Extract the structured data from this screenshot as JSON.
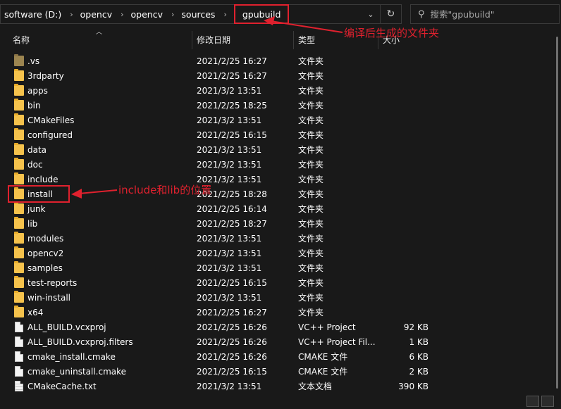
{
  "address_bar": {
    "breadcrumbs": [
      "software (D:)",
      "opencv",
      "opencv",
      "sources",
      "gpubuild"
    ],
    "dropdown_icon": "chevron-down-icon",
    "refresh_icon": "refresh-icon"
  },
  "search": {
    "placeholder": "搜索\"gpubuild\"",
    "icon": "search-icon"
  },
  "columns": {
    "name": "名称",
    "date": "修改日期",
    "type": "类型",
    "size": "大小"
  },
  "files": [
    {
      "name": ".vs",
      "date": "2021/2/25 16:27",
      "type": "文件夹",
      "size": "",
      "icon": "folder-dark-icon"
    },
    {
      "name": "3rdparty",
      "date": "2021/2/25 16:27",
      "type": "文件夹",
      "size": "",
      "icon": "folder-icon"
    },
    {
      "name": "apps",
      "date": "2021/3/2 13:51",
      "type": "文件夹",
      "size": "",
      "icon": "folder-icon"
    },
    {
      "name": "bin",
      "date": "2021/2/25 18:25",
      "type": "文件夹",
      "size": "",
      "icon": "folder-icon"
    },
    {
      "name": "CMakeFiles",
      "date": "2021/3/2 13:51",
      "type": "文件夹",
      "size": "",
      "icon": "folder-icon"
    },
    {
      "name": "configured",
      "date": "2021/2/25 16:15",
      "type": "文件夹",
      "size": "",
      "icon": "folder-icon"
    },
    {
      "name": "data",
      "date": "2021/3/2 13:51",
      "type": "文件夹",
      "size": "",
      "icon": "folder-icon"
    },
    {
      "name": "doc",
      "date": "2021/3/2 13:51",
      "type": "文件夹",
      "size": "",
      "icon": "folder-icon"
    },
    {
      "name": "include",
      "date": "2021/3/2 13:51",
      "type": "文件夹",
      "size": "",
      "icon": "folder-icon"
    },
    {
      "name": "install",
      "date": "2021/2/25 18:28",
      "type": "文件夹",
      "size": "",
      "icon": "folder-icon"
    },
    {
      "name": "junk",
      "date": "2021/2/25 16:14",
      "type": "文件夹",
      "size": "",
      "icon": "folder-icon"
    },
    {
      "name": "lib",
      "date": "2021/2/25 18:27",
      "type": "文件夹",
      "size": "",
      "icon": "folder-icon"
    },
    {
      "name": "modules",
      "date": "2021/3/2 13:51",
      "type": "文件夹",
      "size": "",
      "icon": "folder-icon"
    },
    {
      "name": "opencv2",
      "date": "2021/3/2 13:51",
      "type": "文件夹",
      "size": "",
      "icon": "folder-icon"
    },
    {
      "name": "samples",
      "date": "2021/3/2 13:51",
      "type": "文件夹",
      "size": "",
      "icon": "folder-icon"
    },
    {
      "name": "test-reports",
      "date": "2021/2/25 16:15",
      "type": "文件夹",
      "size": "",
      "icon": "folder-icon"
    },
    {
      "name": "win-install",
      "date": "2021/3/2 13:51",
      "type": "文件夹",
      "size": "",
      "icon": "folder-icon"
    },
    {
      "name": "x64",
      "date": "2021/2/25 16:27",
      "type": "文件夹",
      "size": "",
      "icon": "folder-icon"
    },
    {
      "name": "ALL_BUILD.vcxproj",
      "date": "2021/2/25 16:26",
      "type": "VC++ Project",
      "size": "92 KB",
      "icon": "file-icon"
    },
    {
      "name": "ALL_BUILD.vcxproj.filters",
      "date": "2021/2/25 16:26",
      "type": "VC++ Project Fil...",
      "size": "1 KB",
      "icon": "file-icon"
    },
    {
      "name": "cmake_install.cmake",
      "date": "2021/2/25 16:26",
      "type": "CMAKE 文件",
      "size": "6 KB",
      "icon": "file-icon"
    },
    {
      "name": "cmake_uninstall.cmake",
      "date": "2021/2/25 16:15",
      "type": "CMAKE 文件",
      "size": "2 KB",
      "icon": "file-icon"
    },
    {
      "name": "CMakeCache.txt",
      "date": "2021/3/2 13:51",
      "type": "文本文档",
      "size": "390 KB",
      "icon": "text-file-icon"
    }
  ],
  "annotations": {
    "folder_note": "编译后生成的文件夹",
    "install_note": "include和lib的位置",
    "color": "#e0212e"
  }
}
